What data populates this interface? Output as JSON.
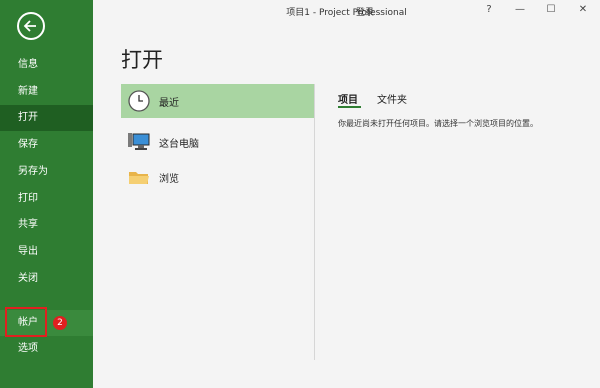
{
  "window": {
    "title": "项目1 - Project Professional",
    "login": "登录",
    "help": "?",
    "minimize": "—",
    "maximize": "☐",
    "close": "✕"
  },
  "sidebar": {
    "back_icon": "back-arrow-icon",
    "items": [
      {
        "label": "信息"
      },
      {
        "label": "新建"
      },
      {
        "label": "打开",
        "active": true
      },
      {
        "label": "保存"
      },
      {
        "label": "另存为"
      },
      {
        "label": "打印"
      },
      {
        "label": "共享"
      },
      {
        "label": "导出"
      },
      {
        "label": "关闭"
      },
      {
        "label": "帐户"
      },
      {
        "label": "选项"
      }
    ],
    "annotation_badge": "2",
    "colors": {
      "background": "#2f7d32",
      "active": "#1f5f22",
      "annotation": "#e02020"
    }
  },
  "main": {
    "title": "打开",
    "places": [
      {
        "label": "最近",
        "icon": "clock-icon",
        "selected": true
      },
      {
        "label": "这台电脑",
        "icon": "computer-icon"
      },
      {
        "label": "浏览",
        "icon": "folder-icon"
      }
    ],
    "tabs": [
      {
        "label": "项目",
        "active": true
      },
      {
        "label": "文件夹"
      }
    ],
    "empty_message": "你最近尚未打开任何项目。请选择一个浏览项目的位置。"
  }
}
